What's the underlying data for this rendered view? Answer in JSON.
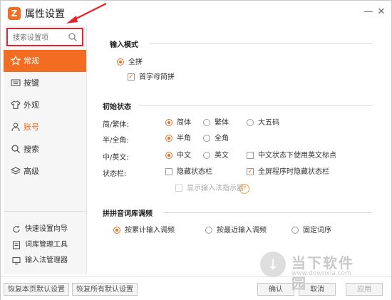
{
  "window": {
    "title": "属性设置",
    "logo_glyph": "Z",
    "accent": "#f26c22",
    "highlight": "#e8232b"
  },
  "sidebar": {
    "search_placeholder": "搜索设置项",
    "items": [
      {
        "label": "常规",
        "icon": "star-icon"
      },
      {
        "label": "按键",
        "icon": "keyboard-icon"
      },
      {
        "label": "外观",
        "icon": "shirt-icon"
      },
      {
        "label": "账号",
        "icon": "user-icon"
      },
      {
        "label": "搜索",
        "icon": "search-icon"
      },
      {
        "label": "高级",
        "icon": "layers-icon"
      }
    ],
    "bottom_items": [
      {
        "label": "快速设置向导",
        "icon": "refresh-icon"
      },
      {
        "label": "词库管理工具",
        "icon": "book-icon"
      },
      {
        "label": "输入法管理器",
        "icon": "monitor-icon"
      }
    ]
  },
  "input_mode": {
    "title": "输入模式",
    "quanpin": "全拼",
    "shouzimu": "首字母简拼"
  },
  "initial_state": {
    "title": "初始状态",
    "row1": {
      "label": "简/繁体:",
      "opt1": "简体",
      "opt2": "繁体",
      "opt3": "大五码"
    },
    "row2": {
      "label": "半/全角:",
      "opt1": "半角",
      "opt2": "全角"
    },
    "row3": {
      "label": "中/英文:",
      "opt1": "中文",
      "opt2": "英文",
      "opt3": "中文状态下使用英文标点"
    },
    "row4": {
      "label": "状态栏:",
      "opt1": "隐藏状态栏",
      "opt2": "全屏程序时隐藏状态栏"
    },
    "show_indicator": "显示输入法指示器",
    "help_glyph": "?"
  },
  "ciku": {
    "title": "拼拼音词库调频",
    "opt1": "按累计输入调频",
    "opt2": "按最近输入调频",
    "opt3": "固定词序"
  },
  "footer": {
    "restore_page": "恢复本页默认设置",
    "restore_all": "恢复所有默认设置",
    "ok": "确认",
    "cancel": "取消",
    "apply": "应用"
  },
  "watermark": {
    "text1": "当下软件园",
    "text2": "www.downxia.com",
    "glyph": "↓"
  }
}
